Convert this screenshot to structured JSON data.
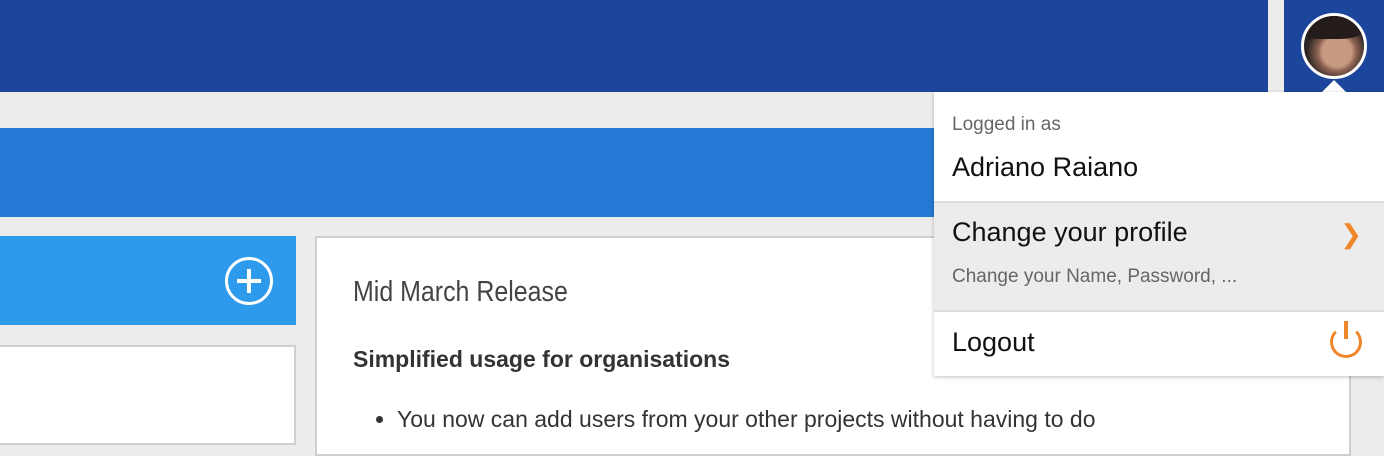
{
  "user_menu": {
    "logged_in_label": "Logged in as",
    "user_name": "Adriano Raiano",
    "change_profile": "Change your profile",
    "change_profile_sub": "Change your Name, Password, ...",
    "logout": "Logout"
  },
  "release": {
    "title": "Mid March Release",
    "subtitle": "Simplified usage for organisations",
    "bullets": [
      "You now can add users from your other projects without having to do"
    ]
  },
  "colors": {
    "topbar": "#1c469c",
    "band": "#2479d4",
    "panel": "#2d9aec",
    "accent": "#f0862a"
  }
}
